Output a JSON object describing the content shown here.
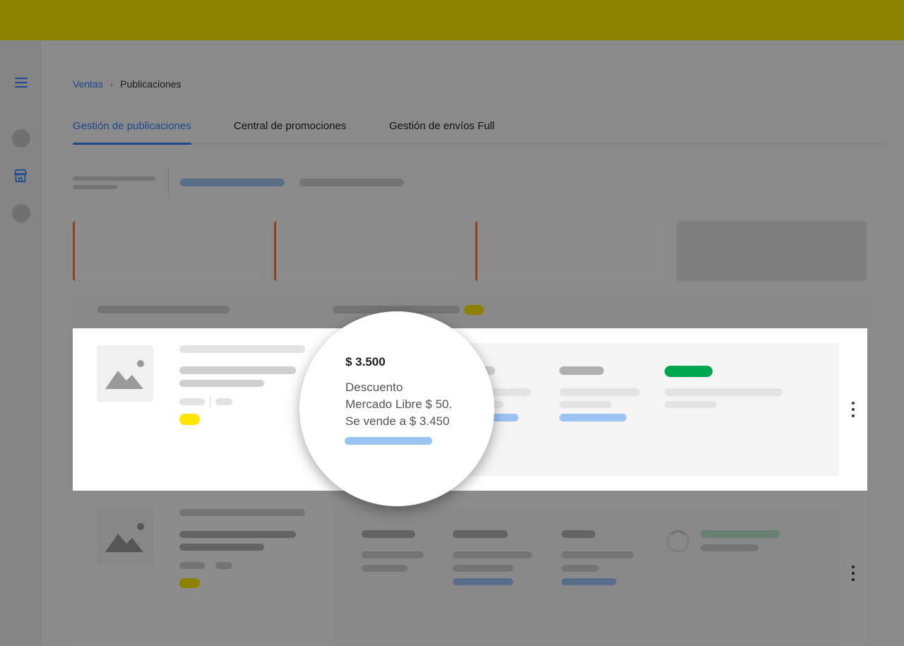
{
  "breadcrumb": {
    "parent": "Ventas",
    "separator": "›",
    "current": "Publicaciones"
  },
  "tabs": [
    {
      "label": "Gestión de publicaciones",
      "active": true
    },
    {
      "label": "Central de promociones",
      "active": false
    },
    {
      "label": "Gestión de envíos Full",
      "active": false
    }
  ],
  "tooltip": {
    "price": "$ 3.500",
    "line1": "Descuento",
    "line2": "Mercado Libre $ 50.",
    "line3": "Se vende a $ 3.450"
  },
  "colors": {
    "brand_yellow": "#ffe600",
    "accent_blue": "#3483fa",
    "warning_orange": "#ff7733",
    "success_green": "#00a650"
  },
  "icons": [
    "menu-icon",
    "store-icon",
    "image-placeholder-icon",
    "more-vertical-icon"
  ]
}
